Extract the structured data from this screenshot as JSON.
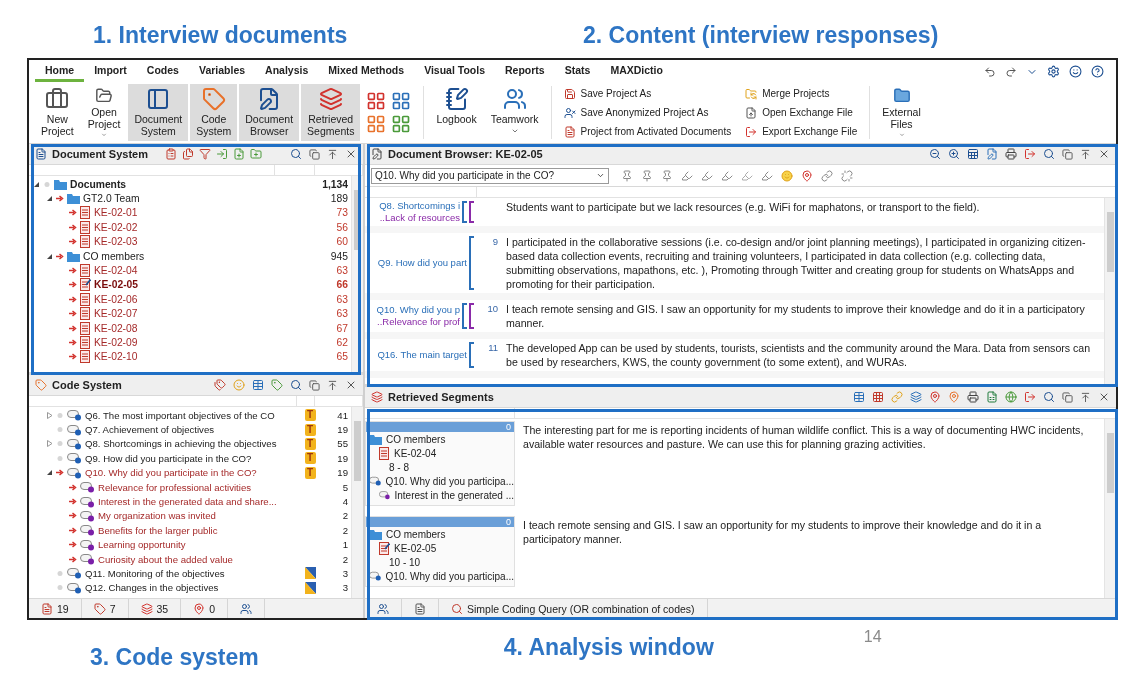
{
  "slide": {
    "top_captions": [
      {
        "text": "1. Interview documents"
      },
      {
        "text": "2.  Content (interview responses)"
      }
    ],
    "bottom_captions": [
      {
        "text": "3. Code system"
      },
      {
        "text": "4. Analysis window"
      }
    ],
    "page_number": "14"
  },
  "ribbon": {
    "tabs": [
      {
        "label": "Home",
        "selected": true
      },
      {
        "label": "Import",
        "selected": false
      },
      {
        "label": "Codes",
        "selected": false
      },
      {
        "label": "Variables",
        "selected": false
      },
      {
        "label": "Analysis",
        "selected": false
      },
      {
        "label": "Mixed Methods",
        "selected": false
      },
      {
        "label": "Visual Tools",
        "selected": false
      },
      {
        "label": "Reports",
        "selected": false
      },
      {
        "label": "Stats",
        "selected": false
      },
      {
        "label": "MAXDictio",
        "selected": false
      }
    ],
    "left_buttons": [
      {
        "kind": "new",
        "lines": [
          "New",
          "Project"
        ],
        "menu": false,
        "pressed": false
      },
      {
        "kind": "open",
        "lines": [
          "Open",
          "Project"
        ],
        "menu": true,
        "pressed": false
      },
      {
        "kind": "docsys",
        "lines": [
          "Document",
          "System"
        ],
        "menu": false,
        "pressed": true
      },
      {
        "kind": "codesys",
        "lines": [
          "Code",
          "System"
        ],
        "menu": false,
        "pressed": true
      },
      {
        "kind": "browser",
        "lines": [
          "Document",
          "Browser"
        ],
        "menu": false,
        "pressed": true
      },
      {
        "kind": "retrieved",
        "lines": [
          "Retrieved",
          "Segments"
        ],
        "menu": false,
        "pressed": true
      }
    ],
    "right_buttons": [
      {
        "kind": "logbook",
        "lines": [
          "Logbook"
        ],
        "menu": false,
        "pressed": false
      },
      {
        "kind": "teamwork",
        "lines": [
          "Teamwork"
        ],
        "menu": true,
        "pressed": false
      }
    ],
    "small_buttons": [
      {
        "kind": "save",
        "label": "Save Project As"
      },
      {
        "kind": "anon",
        "label": "Save Anonymized Project As"
      },
      {
        "kind": "fromdocs",
        "label": "Project from Activated Documents"
      },
      {
        "kind": "merge",
        "label": "Merge Projects"
      },
      {
        "kind": "openx",
        "label": "Open Exchange File"
      },
      {
        "kind": "exportx",
        "label": "Export Exchange File"
      }
    ],
    "end_buttons": [
      {
        "kind": "external",
        "lines": [
          "External",
          "Files"
        ],
        "menu": true,
        "pressed": false
      }
    ]
  },
  "document_system": {
    "title": "Document System",
    "tree": [
      {
        "label": "Documents",
        "count": "1,134",
        "kind": "root",
        "activated": false,
        "expanded": true,
        "selected": false,
        "children": [
          {
            "label": "GT2.0 Team",
            "count": "189",
            "kind": "set",
            "activated": true,
            "expanded": true,
            "selected": false,
            "children": [
              {
                "label": "KE-02-01",
                "count": "73",
                "kind": "document",
                "activated": true,
                "selected": false
              },
              {
                "label": "KE-02-02",
                "count": "56",
                "kind": "document",
                "activated": true,
                "selected": false
              },
              {
                "label": "KE-02-03",
                "count": "60",
                "kind": "document",
                "activated": true,
                "selected": false
              }
            ]
          },
          {
            "label": "CO members",
            "count": "945",
            "kind": "set",
            "activated": true,
            "expanded": true,
            "selected": false,
            "children": [
              {
                "label": "KE-02-04",
                "count": "63",
                "kind": "document",
                "activated": true,
                "selected": false
              },
              {
                "label": "KE-02-05",
                "count": "66",
                "kind": "document",
                "activated": true,
                "selected": true
              },
              {
                "label": "KE-02-06",
                "count": "63",
                "kind": "document",
                "activated": true,
                "selected": false
              },
              {
                "label": "KE-02-07",
                "count": "63",
                "kind": "document",
                "activated": true,
                "selected": false
              },
              {
                "label": "KE-02-08",
                "count": "67",
                "kind": "document",
                "activated": true,
                "selected": false
              },
              {
                "label": "KE-02-09",
                "count": "62",
                "kind": "document",
                "activated": true,
                "selected": false
              },
              {
                "label": "KE-02-10",
                "count": "65",
                "kind": "document",
                "activated": true,
                "selected": false
              }
            ]
          }
        ]
      }
    ]
  },
  "code_system": {
    "title": "Code System",
    "codes": [
      {
        "label": "Q6. The most important objectives of the CO",
        "count": "41",
        "color": "#1f5fb4",
        "activated": false,
        "expanded": false,
        "memo": {
          "kind": "text",
          "label": "T"
        }
      },
      {
        "label": "Q7. Achievement of objectives",
        "count": "19",
        "color": "#1f5fb4",
        "activated": false,
        "memo": {
          "kind": "text",
          "label": "T"
        }
      },
      {
        "label": "Q8. Shortcomings in achieving the objectives",
        "count": "55",
        "color": "#1f5fb4",
        "activated": false,
        "expanded": false,
        "memo": {
          "kind": "text",
          "label": "T"
        }
      },
      {
        "label": "Q9. How did you participate in the CO?",
        "count": "19",
        "color": "#1f5fb4",
        "activated": false,
        "memo": {
          "kind": "text",
          "label": "T"
        }
      },
      {
        "label": "Q10. Why did you participate in the CO?",
        "count": "19",
        "color": "#1f5fb4",
        "activated": true,
        "expanded": true,
        "memo": {
          "kind": "text",
          "label": "T"
        },
        "children": [
          {
            "label": "Relevance for professional activities",
            "count": "5",
            "color": "#7a1fa8",
            "activated": true
          },
          {
            "label": "Interest in the generated data and share...",
            "count": "4",
            "color": "#7a1fa8",
            "activated": true
          },
          {
            "label": "My organization was invited",
            "count": "2",
            "color": "#7a1fa8",
            "activated": true
          },
          {
            "label": "Benefits for the larger public",
            "count": "2",
            "color": "#7a1fa8",
            "activated": true
          },
          {
            "label": "Learning opportunity",
            "count": "1",
            "color": "#7a1fa8",
            "activated": true
          },
          {
            "label": "Curiosity about the added value",
            "count": "2",
            "color": "#7a1fa8",
            "activated": true
          }
        ]
      },
      {
        "label": "Q11. Monitoring of the objectives",
        "count": "3",
        "color": "#1f5fb4",
        "activated": false,
        "memo": {
          "kind": "flag"
        }
      },
      {
        "label": "Q12. Changes in the objectives",
        "count": "3",
        "color": "#1f5fb4",
        "activated": false,
        "memo": {
          "kind": "flag"
        }
      }
    ],
    "status": [
      {
        "kind": "documents",
        "value": "19"
      },
      {
        "kind": "codes",
        "value": "7"
      },
      {
        "kind": "segments",
        "value": "35"
      },
      {
        "kind": "memos",
        "value": "0"
      }
    ]
  },
  "document_browser": {
    "title": "Document Browser: KE-02-05",
    "code_filter": "Q10. Why did you participate in the CO?",
    "paragraphs": [
      {
        "text": "Students want to participate but we lack resources (e.g. WiFi for maphatons, or transport to the field).",
        "stripes": [
          {
            "label": "Q8. Shortcomings i",
            "color": "#2a6fb8"
          },
          {
            "label": "..Lack of resources",
            "color": "#8a2aa8"
          }
        ]
      },
      {
        "number": "9",
        "text": "I participated in the collaborative sessions (i.e. co-design and/or joint planning meetings), I participated in organizing citizen-based data collection events, recruiting and training volunteers, I participated in data collection (e.g. collecting data, submitting observations, mapathons, etc. ), Promoting through Twitter and creating group for students on WhatsApps and promoting for their participation.",
        "stripes": [
          {
            "label": "Q9. How did you part",
            "color": "#2a6fb8"
          }
        ]
      },
      {
        "number": "10",
        "text": "I teach remote sensing and GIS. I saw an opportunity for my students to improve their knowledge and do it in a participatory manner.",
        "stripes": [
          {
            "label": "Q10. Why did you p",
            "color": "#2a6fb8"
          },
          {
            "label": "..Relevance for prof",
            "color": "#8a2aa8"
          }
        ]
      },
      {
        "number": "11",
        "text": "The developed App can be used by students, tourists, scientists and the community around the Mara. Data from sensors can be used by researchers, KWS, the county government (to some extent), and WURAs.",
        "stripes": [
          {
            "label": "Q16. The main target",
            "color": "#2a6fb8"
          }
        ]
      }
    ]
  },
  "retrieved_segments": {
    "title": "Retrieved Segments",
    "segments": [
      {
        "count": "0",
        "set": "CO members",
        "document": "KE-02-04",
        "range": "8 - 8",
        "code": "Q10. Why did you participa...",
        "subcode": "Interest in the generated ...",
        "text": "The interesting part for me is reporting incidents of human wildlife conflict. This is a way of documenting HWC incidents, available water resources and pasture. We can use this for planning grazing activities."
      },
      {
        "count": "0",
        "set": "CO members",
        "document": "KE-02-05",
        "range": "10 - 10",
        "code": "Q10. Why did you participa...",
        "text": "I teach remote sensing and GIS. I saw an opportunity for my students to improve their knowledge and do it in a participatory manner."
      }
    ],
    "status": "Simple Coding Query (OR combination of codes)"
  }
}
